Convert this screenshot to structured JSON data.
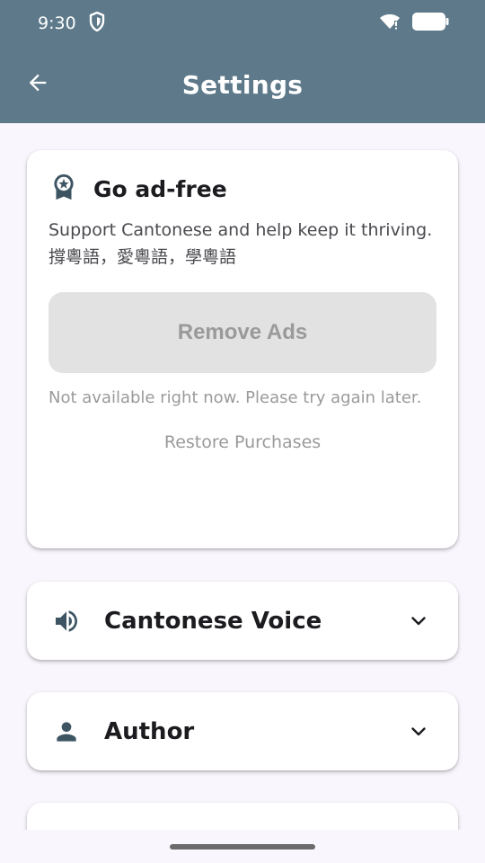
{
  "status_bar": {
    "time": "9:30",
    "icons": [
      "shield-icon",
      "wifi-icon",
      "battery-icon"
    ]
  },
  "app_bar": {
    "title": "Settings",
    "back_icon": "arrow-back-icon"
  },
  "ad_free": {
    "icon": "award-icon",
    "title": "Go ad-free",
    "description_line1": "Support Cantonese and help keep it thriving.",
    "description_line2": "撐粵語，愛粵語，學粵語",
    "remove_ads_label": "Remove Ads",
    "note": "Not available right now. Please try again later.",
    "restore_label": "Restore Purchases"
  },
  "sections": [
    {
      "icon": "volume-icon",
      "label": "Cantonese Voice",
      "chevron": "chevron-down-icon"
    },
    {
      "icon": "person-icon",
      "label": "Author",
      "chevron": "chevron-down-icon"
    }
  ],
  "colors": {
    "app_bar": "#5e7a8a",
    "background": "#f9f6fd",
    "card": "#ffffff",
    "icon": "#3d5563",
    "disabled_button": "#e2e2e2",
    "disabled_text": "#9a9a9a"
  }
}
